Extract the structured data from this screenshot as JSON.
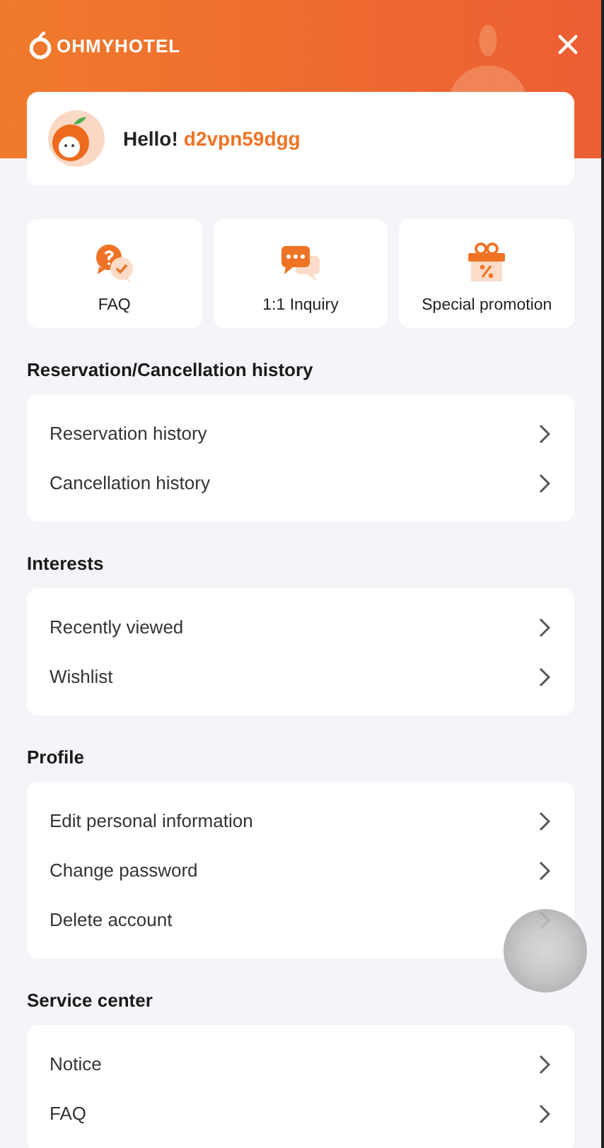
{
  "header": {
    "logo": "OHMYHOTEL"
  },
  "greeting": {
    "label": "Hello!",
    "username": "d2vpn59dgg"
  },
  "shortcuts": [
    {
      "label": "FAQ",
      "kind": "faq"
    },
    {
      "label": "1:1 Inquiry",
      "kind": "inquiry"
    },
    {
      "label": "Special promotion",
      "kind": "gift"
    }
  ],
  "sections": [
    {
      "title": "Reservation/Cancellation history",
      "items": [
        {
          "label": "Reservation history"
        },
        {
          "label": "Cancellation history"
        }
      ]
    },
    {
      "title": "Interests",
      "items": [
        {
          "label": "Recently viewed"
        },
        {
          "label": "Wishlist"
        }
      ]
    },
    {
      "title": "Profile",
      "items": [
        {
          "label": "Edit personal information"
        },
        {
          "label": "Change password"
        },
        {
          "label": "Delete account"
        }
      ]
    },
    {
      "title": "Service center",
      "items": [
        {
          "label": "Notice"
        },
        {
          "label": "FAQ"
        }
      ]
    }
  ]
}
